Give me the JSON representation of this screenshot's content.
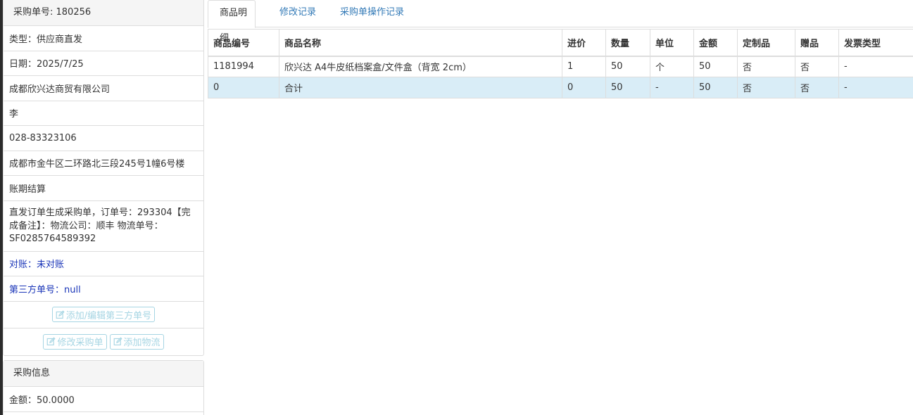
{
  "order_panel": {
    "heading": "采购单号: 180256",
    "type_line": "类型：供应商直发",
    "date_line": "日期：2025/7/25",
    "supplier": "成都欣兴达商贸有限公司",
    "contact": "李",
    "phone": "028-83323106",
    "address": "成都市金牛区二环路北三段245号1幢6号楼",
    "payment": "账期结算",
    "remark": "直发订单生成采购单，订单号：293304【完成备注】：物流公司：顺丰 物流单号：SF0285764589392",
    "reconcile": "对账：未对账",
    "third_party_no": "第三方单号：null",
    "edit_third_party_button": "添加/编辑第三方单号",
    "edit_order_button": "修改采购单",
    "add_logistics_button": "添加物流"
  },
  "purchase_info": {
    "heading": "采购信息",
    "amount_line": "金额：50.0000"
  },
  "tabs": [
    "商品明细",
    "修改记录",
    "采购单操作记录"
  ],
  "table": {
    "headers": [
      "商品编号",
      "商品名称",
      "进价",
      "数量",
      "单位",
      "金额",
      "定制品",
      "赠品",
      "发票类型"
    ],
    "rows": [
      [
        "1181994",
        "欣兴达 A4牛皮纸档案盒/文件盒（背宽 2cm）",
        "1",
        "50",
        "个",
        "50",
        "否",
        "否",
        "-"
      ]
    ],
    "total_row": [
      "0",
      "合计",
      "0",
      "50",
      "-",
      "50",
      "否",
      "否",
      "-"
    ]
  },
  "colors": {
    "link_blue": "#337ab7",
    "text_blue": "#1a35b8",
    "total_row_bg": "#d9edf7",
    "ghost_button": "#a6d5e3"
  },
  "icons": {
    "edit_icon": "edit-icon"
  }
}
